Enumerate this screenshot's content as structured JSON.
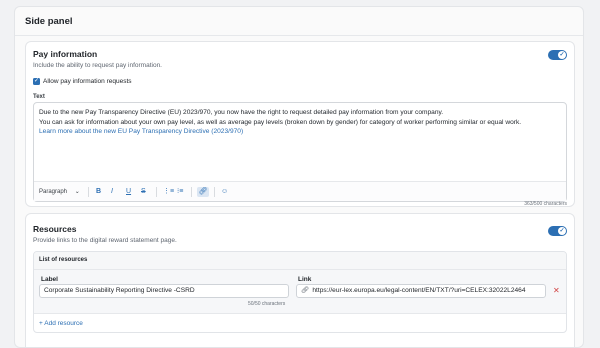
{
  "panel": {
    "title": "Side panel"
  },
  "pay": {
    "title": "Pay information",
    "subtitle": "Include the ability to request pay information.",
    "toggle_on": true,
    "checkbox_label": "Allow pay information requests",
    "checkbox_checked": true,
    "text_label": "Text",
    "lines": [
      "Due to the new Pay Transparency Directive (EU) 2023/970, you now have the right to request detailed pay information from your company.",
      "You can ask for information about your own pay level, as well as average pay levels (broken down by gender) for category of worker performing similar or equal work."
    ],
    "link_text": "Learn more about the new EU Pay Transparency Directive (2023/970)",
    "toolbar": {
      "paragraph": "Paragraph",
      "bold": "B",
      "italic": "I",
      "underline": "U",
      "strike": "S"
    },
    "char_count": "363/500 characters"
  },
  "resources": {
    "title": "Resources",
    "subtitle": "Provide links to the digital reward statement page.",
    "toggle_on": true,
    "list_title": "List of resources",
    "label_header": "Label",
    "link_header": "Link",
    "label_value": "Corporate Sustainability Reporting Directive -CSRD",
    "label_chars": "50/50 characters",
    "link_value": "https://eur-lex.europa.eu/legal-content/EN/TXT/?uri=CELEX:32022L2464",
    "add_label": "+ Add resource"
  },
  "colors": {
    "accent": "#2c6fb3",
    "danger": "#d14343"
  },
  "icons": [
    "check-icon",
    "chevron-down-icon",
    "numbered-list-icon",
    "bullet-list-icon",
    "link-icon",
    "emoji-icon",
    "close-icon"
  ]
}
